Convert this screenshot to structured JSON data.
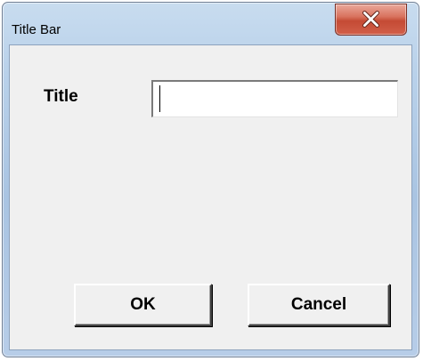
{
  "window": {
    "title": "Title Bar"
  },
  "form": {
    "title_label": "Title",
    "title_value": ""
  },
  "buttons": {
    "ok_label": "OK",
    "cancel_label": "Cancel"
  },
  "icons": {
    "close": "close-icon"
  },
  "colors": {
    "titlebar": "#b9d1ea",
    "close_button": "#c44a34",
    "client_background": "#f0f0f0"
  }
}
